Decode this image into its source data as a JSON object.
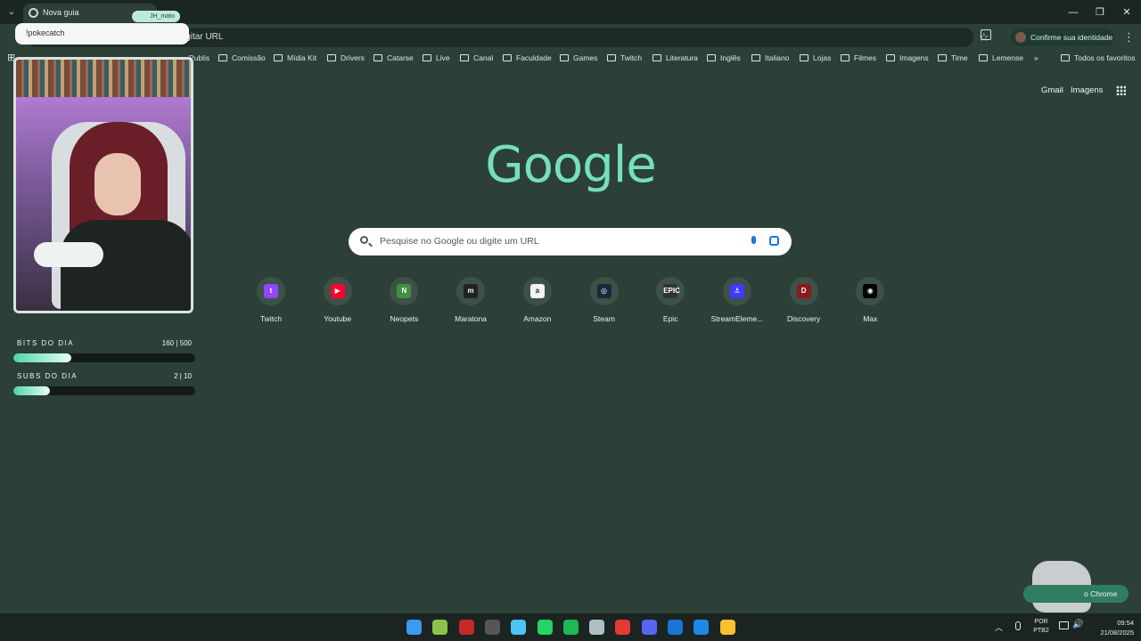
{
  "browser": {
    "tab_title": "Nova guia",
    "omnibox_text": "igitar URL",
    "identity_button": "Confirme sua identidade",
    "window_controls": [
      "minimize-icon",
      "restore-icon",
      "close-icon"
    ]
  },
  "bookmarks": {
    "items": [
      "Publis",
      "Comissão",
      "Mídia Kit",
      "Drivers",
      "Catarse",
      "Live",
      "Canal",
      "Faculdade",
      "Games",
      "Twitch",
      "Literatura",
      "Inglês",
      "Italiano",
      "Lojas",
      "Filmes",
      "Imagens",
      "Time",
      "Lemense"
    ],
    "overflow": "»",
    "all_bookmarks": "Todos os favoritos"
  },
  "overlay": {
    "chat_message": "!pokecatch",
    "chat_user": "JH_mato",
    "bits_label": "BITS DO DIA",
    "bits_value": "160 | 500",
    "bits_fraction": 0.32,
    "subs_label": "SUBS DO DIA",
    "subs_value": "2 | 10",
    "subs_fraction": 0.2
  },
  "ntp": {
    "gmail": "Gmail",
    "images": "Imagens",
    "logo": "Google",
    "search_placeholder": "Pesquise no Google ou digite um URL",
    "customize": "o Chrome",
    "shortcuts": [
      {
        "label": "Twitch",
        "glyph": "t",
        "color": "#9146ff"
      },
      {
        "label": "Youtube",
        "glyph": "▶",
        "color": "#ff0033"
      },
      {
        "label": "Neopets",
        "glyph": "N",
        "color": "#3f8f3f"
      },
      {
        "label": "Maratona",
        "glyph": "m",
        "color": "#222222"
      },
      {
        "label": "Amazon",
        "glyph": "a",
        "color": "#f2f2f2"
      },
      {
        "label": "Steam",
        "glyph": "◎",
        "color": "#1b2838"
      },
      {
        "label": "Epic",
        "glyph": "EPIC",
        "color": "#333333"
      },
      {
        "label": "StreamEleme...",
        "glyph": "⚓",
        "color": "#3b3bff"
      },
      {
        "label": "Discovery",
        "glyph": "D",
        "color": "#8b1a1a"
      },
      {
        "label": "Max",
        "glyph": "◉",
        "color": "#000000"
      }
    ]
  },
  "taskbar": {
    "icons": [
      {
        "name": "windows-start-icon",
        "color": "#3a9bf0"
      },
      {
        "name": "app-green-arrow-icon",
        "color": "#8bc34a"
      },
      {
        "name": "video-app-icon",
        "color": "#c62828"
      },
      {
        "name": "obs-icon",
        "color": "#555555"
      },
      {
        "name": "notepad-icon",
        "color": "#4fc3f7"
      },
      {
        "name": "whatsapp-icon",
        "color": "#25d366"
      },
      {
        "name": "spotify-icon",
        "color": "#1db954"
      },
      {
        "name": "app-wave-icon",
        "color": "#b0bec5"
      },
      {
        "name": "maps-pin-icon",
        "color": "#e53935"
      },
      {
        "name": "discord-icon",
        "color": "#5865f2"
      },
      {
        "name": "outlook-icon",
        "color": "#1976d2"
      },
      {
        "name": "edge-icon",
        "color": "#1e88e5"
      },
      {
        "name": "chrome-icon",
        "color": "#fbc02d"
      }
    ],
    "lang_line1": "POR",
    "lang_line2": "PTB2",
    "time": "09:54",
    "date": "21/08/2025"
  }
}
